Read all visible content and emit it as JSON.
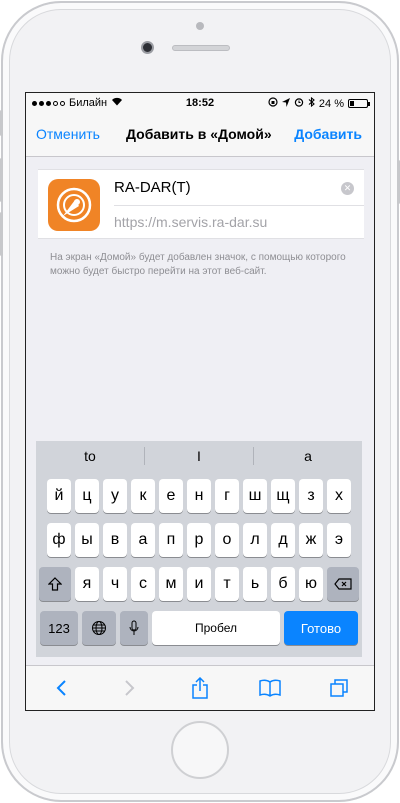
{
  "status_bar": {
    "carrier": "Билайн",
    "time": "18:52",
    "battery_percent": "24 %",
    "battery_level": 0.24
  },
  "nav": {
    "cancel_label": "Отменить",
    "title": "Добавить в «Домой»",
    "add_label": "Добавить"
  },
  "bookmark": {
    "app_icon": "radar-app-icon",
    "title_value": "RA-DAR(T)",
    "url": "https://m.servis.ra-dar.su"
  },
  "hint_text": "На экран «Домой» будет добавлен значок, с помощью которого можно будет быстро перейти на этот веб-сайт.",
  "keyboard": {
    "suggestions": [
      "to",
      "I",
      "a"
    ],
    "row1": [
      "й",
      "ц",
      "у",
      "к",
      "е",
      "н",
      "г",
      "ш",
      "щ",
      "з",
      "х"
    ],
    "row2": [
      "ф",
      "ы",
      "в",
      "а",
      "п",
      "р",
      "о",
      "л",
      "д",
      "ж",
      "э"
    ],
    "row3": [
      "я",
      "ч",
      "с",
      "м",
      "и",
      "т",
      "ь",
      "б",
      "ю"
    ],
    "numbers_label": "123",
    "space_label": "Пробел",
    "done_label": "Готово"
  },
  "colors": {
    "accent": "#0a84ff",
    "icon_orange": "#f08426"
  }
}
